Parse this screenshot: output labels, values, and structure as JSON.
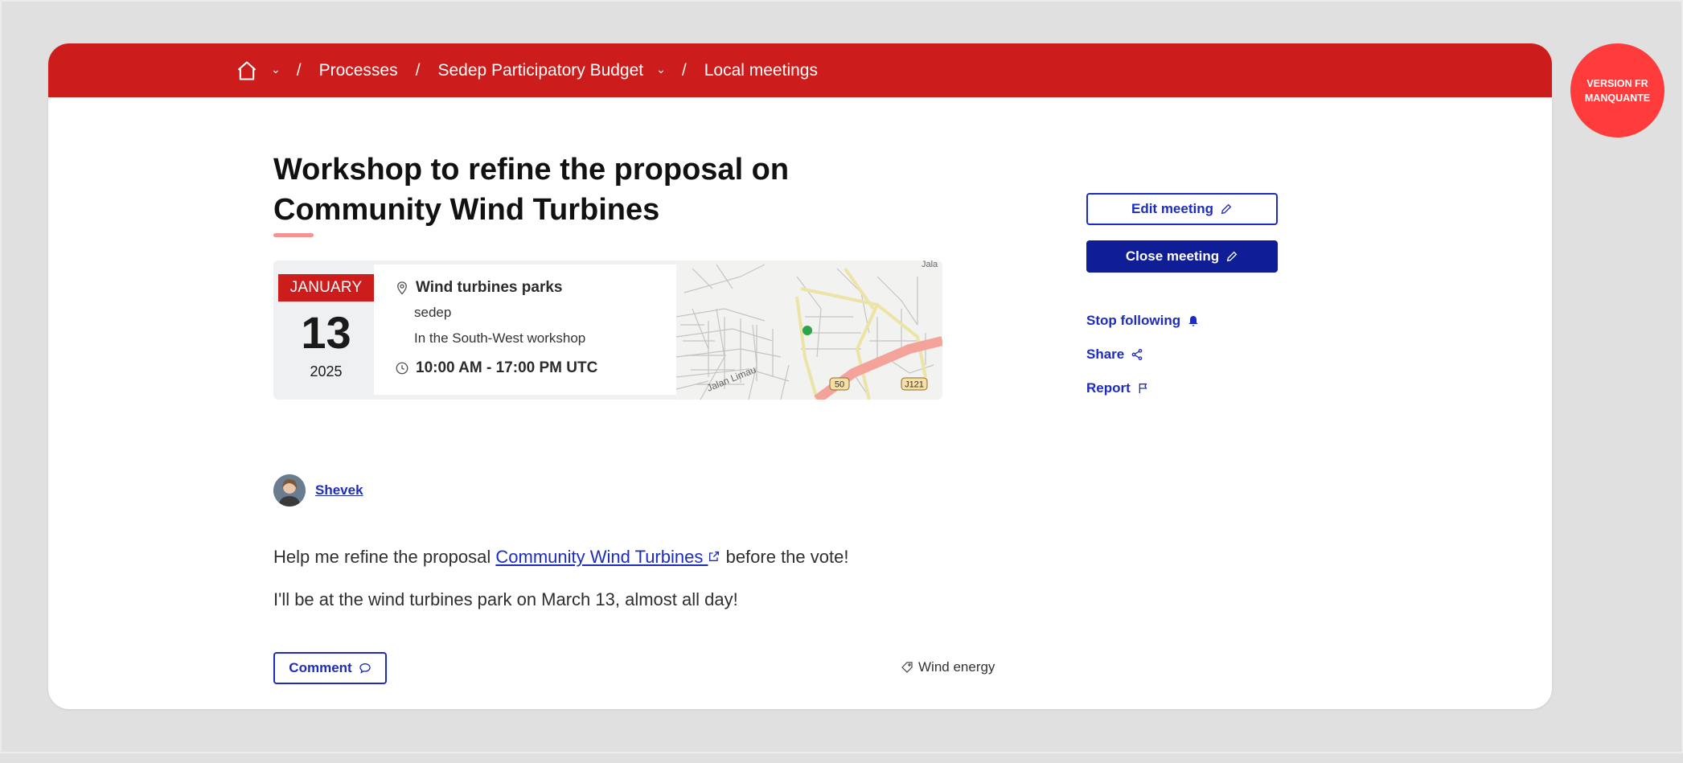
{
  "breadcrumb": {
    "items": [
      "Processes",
      "Sedep Participatory Budget",
      "Local meetings"
    ]
  },
  "badge": {
    "line1": "VERSION FR",
    "line2": "MANQUANTE"
  },
  "meeting": {
    "title": "Workshop to refine the proposal on Community Wind Turbines",
    "date": {
      "month": "JANUARY",
      "day": "13",
      "year": "2025"
    },
    "location": {
      "name": "Wind turbines parks",
      "line1": "sedep",
      "line2": "In the South-West workshop"
    },
    "time": "10:00 AM - 17:00 PM UTC",
    "map": {
      "road_label": "Jalan Limau",
      "route_1": "50",
      "route_2": "J121",
      "corner_label": "Jala"
    },
    "author": "Shevek",
    "body": {
      "p1_before": "Help me refine the proposal ",
      "p1_link": "Community Wind Turbines ",
      "p1_after": " before the vote!",
      "p2": "I'll be at the wind turbines park on March 13, almost all day!"
    },
    "comment_label": "Comment",
    "tag": "Wind energy"
  },
  "sidebar": {
    "edit_label": "Edit meeting",
    "close_label": "Close meeting",
    "follow_label": "Stop following",
    "share_label": "Share",
    "report_label": "Report"
  },
  "colors": {
    "brand_red": "#cd1c1c",
    "link_blue": "#1d2cc0",
    "primary_button": "#0f1e96",
    "badge_red": "#ff3b3b"
  }
}
